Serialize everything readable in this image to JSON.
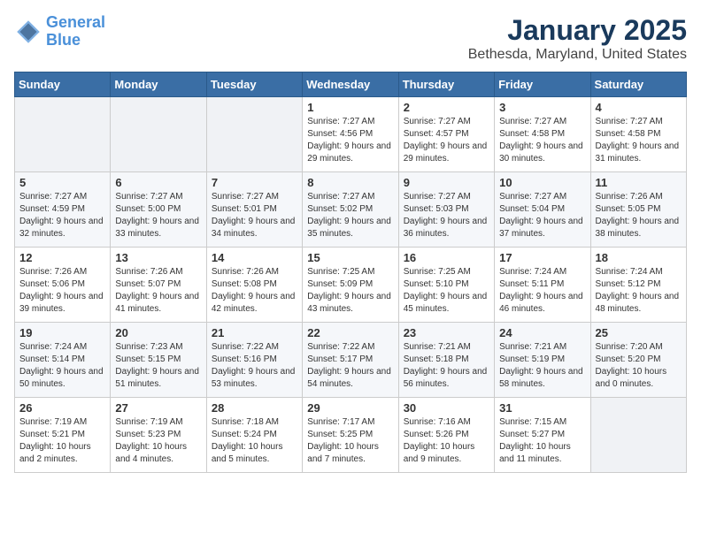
{
  "header": {
    "logo_line1": "General",
    "logo_line2": "Blue",
    "month_title": "January 2025",
    "location": "Bethesda, Maryland, United States"
  },
  "weekdays": [
    "Sunday",
    "Monday",
    "Tuesday",
    "Wednesday",
    "Thursday",
    "Friday",
    "Saturday"
  ],
  "weeks": [
    [
      {
        "day": "",
        "info": ""
      },
      {
        "day": "",
        "info": ""
      },
      {
        "day": "",
        "info": ""
      },
      {
        "day": "1",
        "info": "Sunrise: 7:27 AM\nSunset: 4:56 PM\nDaylight: 9 hours\nand 29 minutes."
      },
      {
        "day": "2",
        "info": "Sunrise: 7:27 AM\nSunset: 4:57 PM\nDaylight: 9 hours\nand 29 minutes."
      },
      {
        "day": "3",
        "info": "Sunrise: 7:27 AM\nSunset: 4:58 PM\nDaylight: 9 hours\nand 30 minutes."
      },
      {
        "day": "4",
        "info": "Sunrise: 7:27 AM\nSunset: 4:58 PM\nDaylight: 9 hours\nand 31 minutes."
      }
    ],
    [
      {
        "day": "5",
        "info": "Sunrise: 7:27 AM\nSunset: 4:59 PM\nDaylight: 9 hours\nand 32 minutes."
      },
      {
        "day": "6",
        "info": "Sunrise: 7:27 AM\nSunset: 5:00 PM\nDaylight: 9 hours\nand 33 minutes."
      },
      {
        "day": "7",
        "info": "Sunrise: 7:27 AM\nSunset: 5:01 PM\nDaylight: 9 hours\nand 34 minutes."
      },
      {
        "day": "8",
        "info": "Sunrise: 7:27 AM\nSunset: 5:02 PM\nDaylight: 9 hours\nand 35 minutes."
      },
      {
        "day": "9",
        "info": "Sunrise: 7:27 AM\nSunset: 5:03 PM\nDaylight: 9 hours\nand 36 minutes."
      },
      {
        "day": "10",
        "info": "Sunrise: 7:27 AM\nSunset: 5:04 PM\nDaylight: 9 hours\nand 37 minutes."
      },
      {
        "day": "11",
        "info": "Sunrise: 7:26 AM\nSunset: 5:05 PM\nDaylight: 9 hours\nand 38 minutes."
      }
    ],
    [
      {
        "day": "12",
        "info": "Sunrise: 7:26 AM\nSunset: 5:06 PM\nDaylight: 9 hours\nand 39 minutes."
      },
      {
        "day": "13",
        "info": "Sunrise: 7:26 AM\nSunset: 5:07 PM\nDaylight: 9 hours\nand 41 minutes."
      },
      {
        "day": "14",
        "info": "Sunrise: 7:26 AM\nSunset: 5:08 PM\nDaylight: 9 hours\nand 42 minutes."
      },
      {
        "day": "15",
        "info": "Sunrise: 7:25 AM\nSunset: 5:09 PM\nDaylight: 9 hours\nand 43 minutes."
      },
      {
        "day": "16",
        "info": "Sunrise: 7:25 AM\nSunset: 5:10 PM\nDaylight: 9 hours\nand 45 minutes."
      },
      {
        "day": "17",
        "info": "Sunrise: 7:24 AM\nSunset: 5:11 PM\nDaylight: 9 hours\nand 46 minutes."
      },
      {
        "day": "18",
        "info": "Sunrise: 7:24 AM\nSunset: 5:12 PM\nDaylight: 9 hours\nand 48 minutes."
      }
    ],
    [
      {
        "day": "19",
        "info": "Sunrise: 7:24 AM\nSunset: 5:14 PM\nDaylight: 9 hours\nand 50 minutes."
      },
      {
        "day": "20",
        "info": "Sunrise: 7:23 AM\nSunset: 5:15 PM\nDaylight: 9 hours\nand 51 minutes."
      },
      {
        "day": "21",
        "info": "Sunrise: 7:22 AM\nSunset: 5:16 PM\nDaylight: 9 hours\nand 53 minutes."
      },
      {
        "day": "22",
        "info": "Sunrise: 7:22 AM\nSunset: 5:17 PM\nDaylight: 9 hours\nand 54 minutes."
      },
      {
        "day": "23",
        "info": "Sunrise: 7:21 AM\nSunset: 5:18 PM\nDaylight: 9 hours\nand 56 minutes."
      },
      {
        "day": "24",
        "info": "Sunrise: 7:21 AM\nSunset: 5:19 PM\nDaylight: 9 hours\nand 58 minutes."
      },
      {
        "day": "25",
        "info": "Sunrise: 7:20 AM\nSunset: 5:20 PM\nDaylight: 10 hours\nand 0 minutes."
      }
    ],
    [
      {
        "day": "26",
        "info": "Sunrise: 7:19 AM\nSunset: 5:21 PM\nDaylight: 10 hours\nand 2 minutes."
      },
      {
        "day": "27",
        "info": "Sunrise: 7:19 AM\nSunset: 5:23 PM\nDaylight: 10 hours\nand 4 minutes."
      },
      {
        "day": "28",
        "info": "Sunrise: 7:18 AM\nSunset: 5:24 PM\nDaylight: 10 hours\nand 5 minutes."
      },
      {
        "day": "29",
        "info": "Sunrise: 7:17 AM\nSunset: 5:25 PM\nDaylight: 10 hours\nand 7 minutes."
      },
      {
        "day": "30",
        "info": "Sunrise: 7:16 AM\nSunset: 5:26 PM\nDaylight: 10 hours\nand 9 minutes."
      },
      {
        "day": "31",
        "info": "Sunrise: 7:15 AM\nSunset: 5:27 PM\nDaylight: 10 hours\nand 11 minutes."
      },
      {
        "day": "",
        "info": ""
      }
    ]
  ]
}
